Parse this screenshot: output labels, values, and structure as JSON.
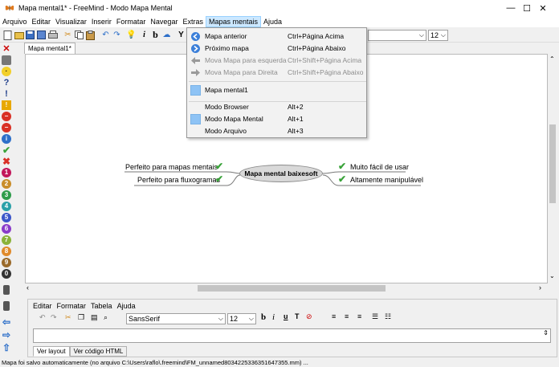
{
  "window": {
    "title": "Mapa mental1* - FreeMind - Modo Mapa Mental",
    "controls": {
      "minimize": "—",
      "maximize": "☐",
      "close": "✕"
    }
  },
  "menubar": [
    {
      "label": "Arquivo"
    },
    {
      "label": "Editar"
    },
    {
      "label": "Visualizar"
    },
    {
      "label": "Inserir"
    },
    {
      "label": "Formatar"
    },
    {
      "label": "Navegar"
    },
    {
      "label": "Extras"
    },
    {
      "label": "Mapas mentais",
      "active": true
    },
    {
      "label": "Ajuda"
    }
  ],
  "toolbar": {
    "font_size": "12"
  },
  "tabs": {
    "document": "Mapa mental1*"
  },
  "dropdown": {
    "items": [
      {
        "label": "Mapa anterior",
        "shortcut": "Ctrl+Página Acima",
        "icon": "prev-map-icon",
        "enabled": true
      },
      {
        "label": "Próximo mapa",
        "shortcut": "Ctrl+Página Abaixo",
        "icon": "next-map-icon",
        "enabled": true
      },
      {
        "label": "Mova Mapa para esquerda",
        "shortcut": "Ctrl+Shift+Página Acima",
        "icon": "arrow-left-icon",
        "enabled": false
      },
      {
        "label": "Mova Mapa para Direita",
        "shortcut": "Ctrl+Shift+Página Abaixo",
        "icon": "arrow-right-icon",
        "enabled": false
      },
      {
        "label": "Mapa mental1",
        "shortcut": "",
        "icon": "selected-map-icon",
        "enabled": true
      },
      {
        "label": "Modo Browser",
        "shortcut": "Alt+2",
        "icon": "",
        "enabled": true
      },
      {
        "label": "Modo Mapa Mental",
        "shortcut": "Alt+1",
        "icon": "selected-mode-icon",
        "enabled": true
      },
      {
        "label": "Modo Arquivo",
        "shortcut": "Alt+3",
        "icon": "",
        "enabled": true
      }
    ]
  },
  "mindmap": {
    "central": "Mapa mental baixesoft",
    "left_nodes": [
      "Perfeito para mapas mentais",
      "Perfeito para fluxogramas"
    ],
    "right_nodes": [
      "Muito fácil de usar",
      "Altamente manipulável"
    ]
  },
  "notes": {
    "menu": [
      "Editar",
      "Formatar",
      "Tabela",
      "Ajuda"
    ],
    "font": "SansSerif",
    "font_size": "12",
    "tabs": [
      "Ver layout",
      "Ver código HTML"
    ]
  },
  "status": "Mapa foi salvo automaticamente (no arquivo C:\\Users\\raflo\\.freemind\\FM_unnamed8034225336351647355.mm) ...",
  "colors": {
    "accent": "#3b7fd9",
    "check": "#3aa33a",
    "menu_highlight": "#cce8ff"
  }
}
